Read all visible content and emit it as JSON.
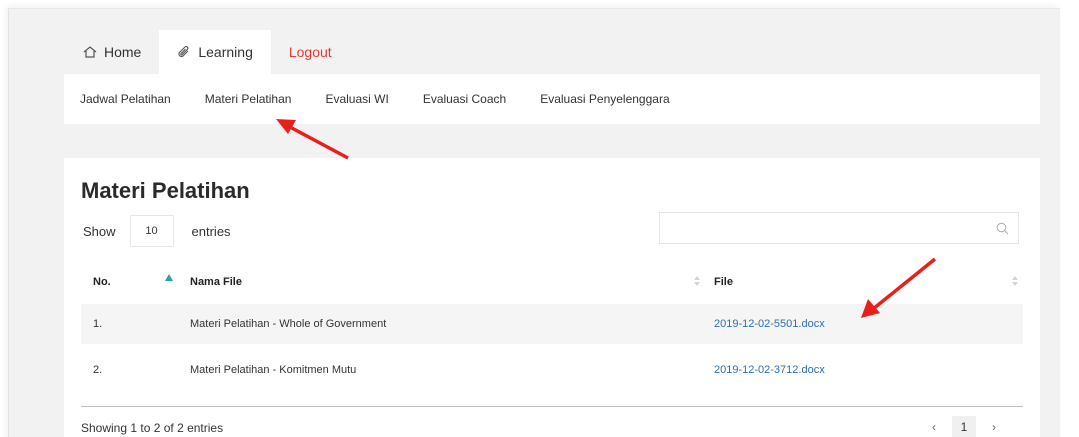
{
  "topnav": {
    "home": "Home",
    "learning": "Learning",
    "logout": "Logout"
  },
  "subnav": {
    "items": [
      "Jadwal Pelatihan",
      "Materi Pelatihan",
      "Evaluasi WI",
      "Evaluasi Coach",
      "Evaluasi Penyelenggara"
    ]
  },
  "page_title": "Materi Pelatihan",
  "length": {
    "show": "Show",
    "value": "10",
    "entries": "entries"
  },
  "search": {
    "placeholder": ""
  },
  "table": {
    "headers": {
      "no": "No.",
      "nama_file": "Nama File",
      "file": "File"
    },
    "rows": [
      {
        "no": "1.",
        "nama_file": "Materi Pelatihan - Whole of Government",
        "file": "2019-12-02-5501.docx"
      },
      {
        "no": "2.",
        "nama_file": "Materi Pelatihan - Komitmen Mutu",
        "file": "2019-12-02-3712.docx"
      }
    ]
  },
  "info": "Showing 1 to 2 of 2 entries",
  "pagination": {
    "prev": "‹",
    "current": "1",
    "next": "›"
  },
  "colors": {
    "accent_sort": "#26a69a",
    "link": "#2c6fb5",
    "logout": "#e53935",
    "annotation_arrow": "#e8201c"
  },
  "icons": [
    "home-icon",
    "paperclip-icon",
    "search-icon",
    "sort-asc-icon",
    "sort-both-icon"
  ]
}
